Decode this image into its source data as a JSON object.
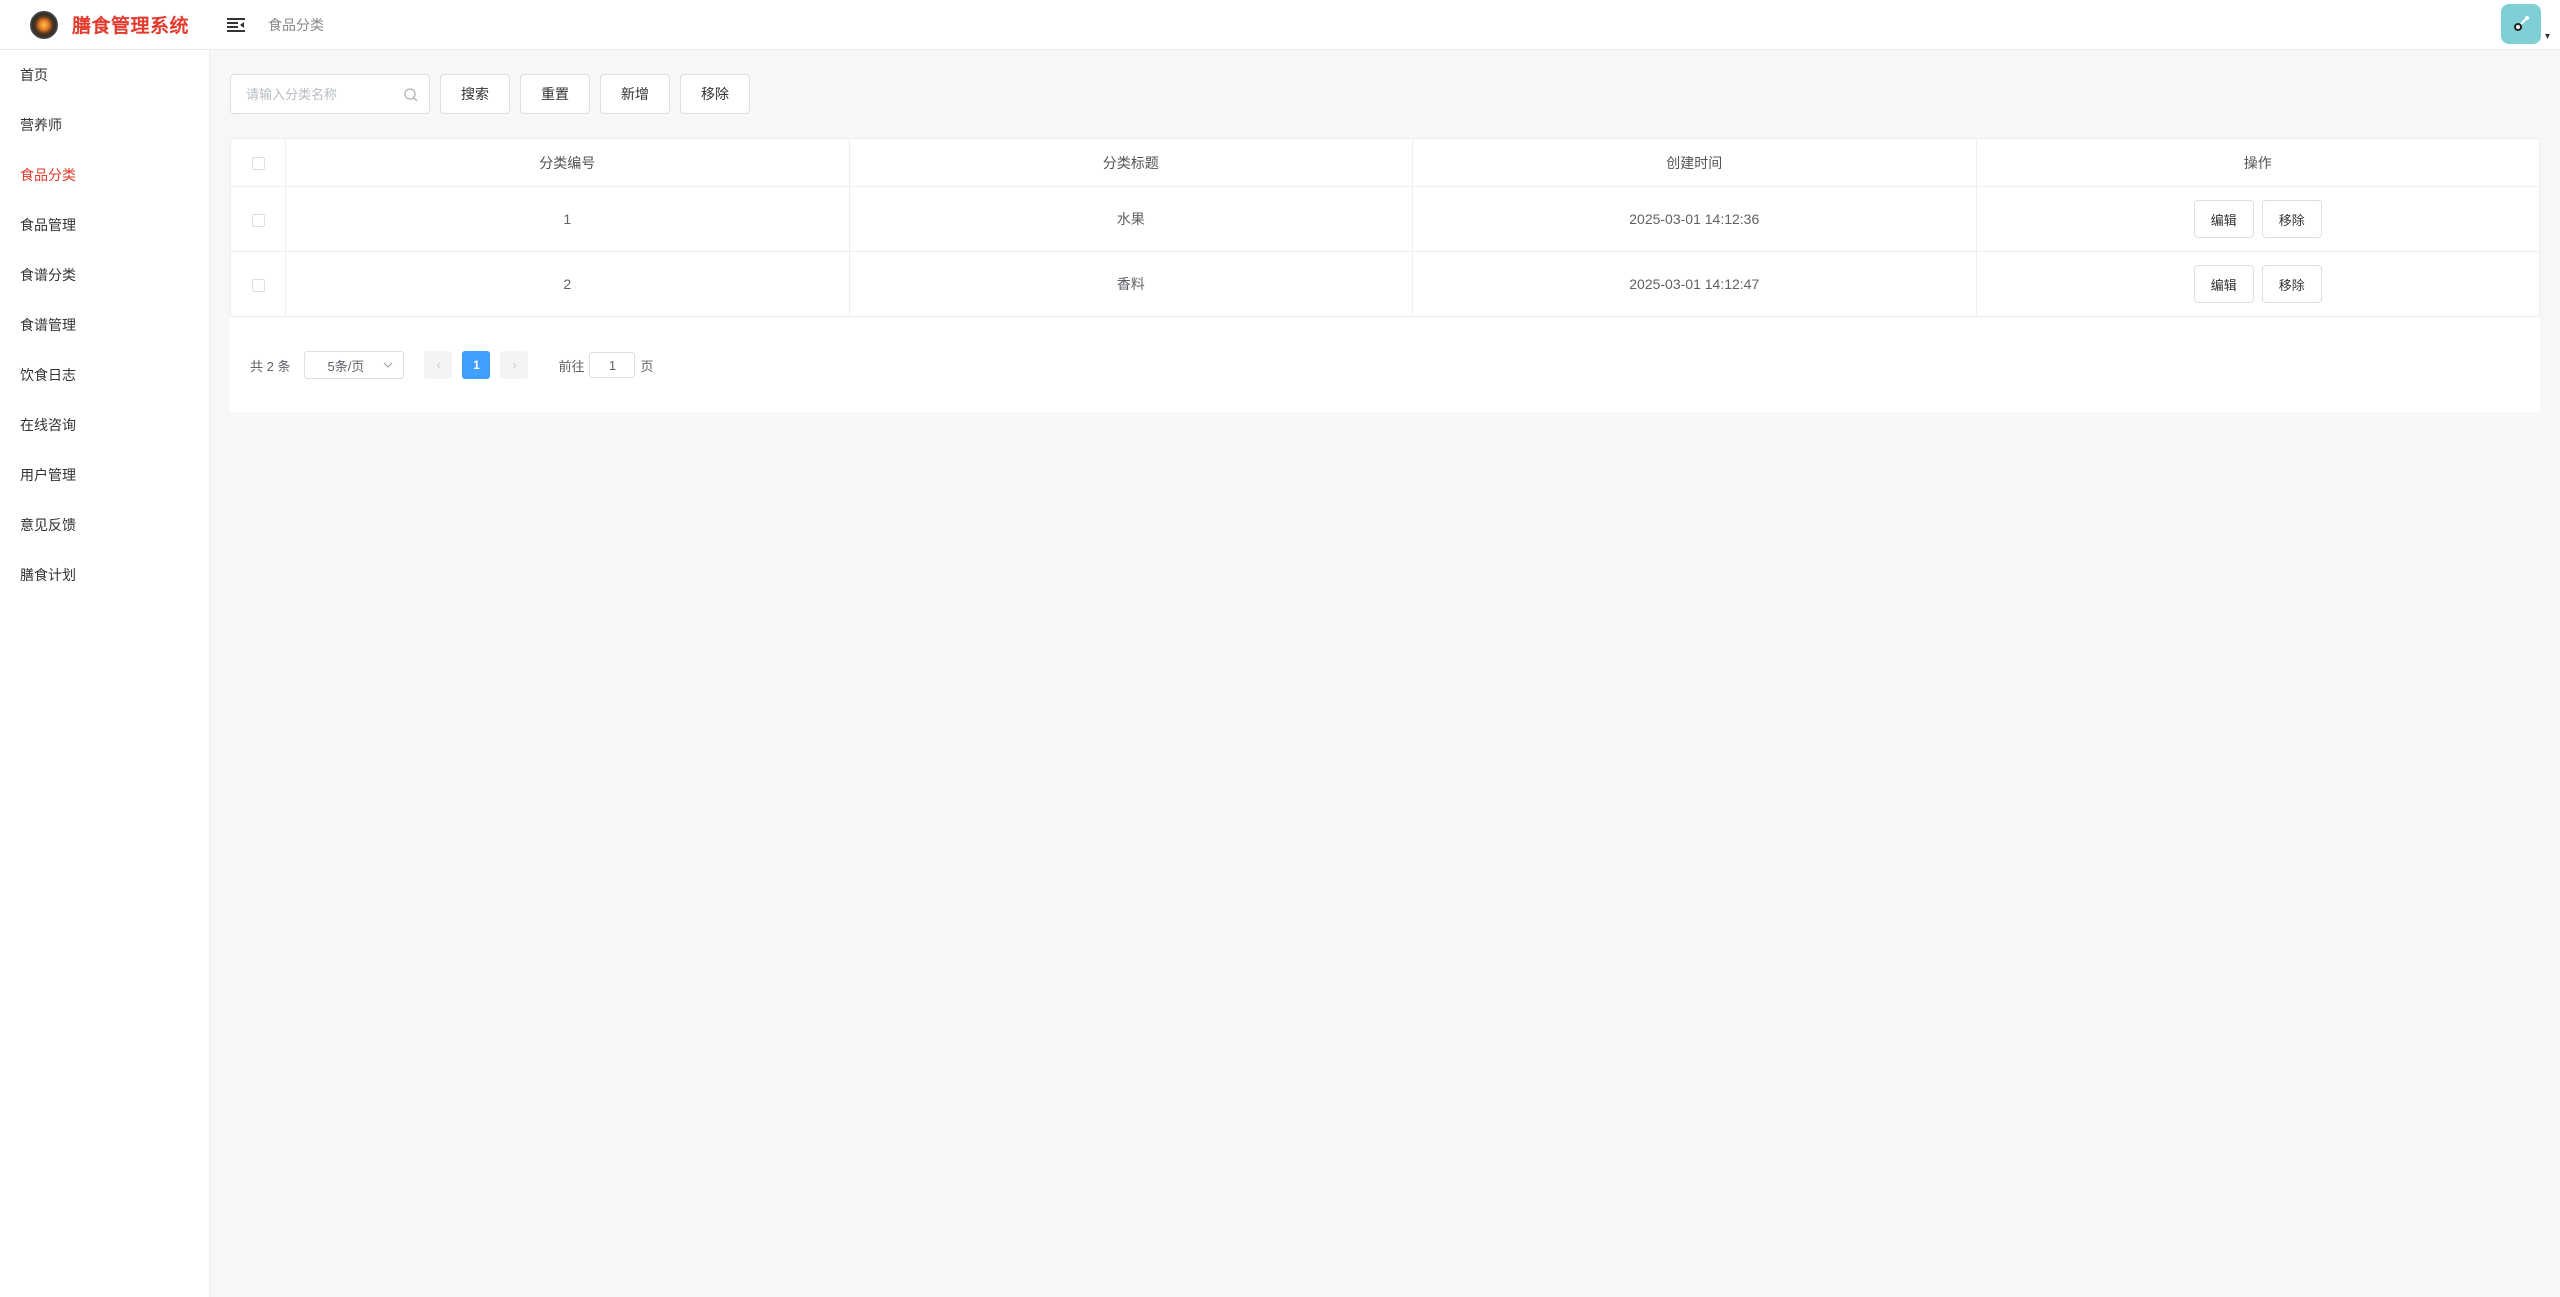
{
  "app": {
    "title": "膳食管理系统",
    "accent_color": "#e23b2e"
  },
  "header": {
    "menu_icon": "menu-fold-icon",
    "breadcrumb": "食品分类",
    "avatar_icon": "avatar-icon",
    "avatar_caret": "▾"
  },
  "sidebar": {
    "items": [
      {
        "label": "首页",
        "active": false
      },
      {
        "label": "营养师",
        "active": false
      },
      {
        "label": "食品分类",
        "active": true
      },
      {
        "label": "食品管理",
        "active": false
      },
      {
        "label": "食谱分类",
        "active": false
      },
      {
        "label": "食谱管理",
        "active": false
      },
      {
        "label": "饮食日志",
        "active": false
      },
      {
        "label": "在线咨询",
        "active": false
      },
      {
        "label": "用户管理",
        "active": false
      },
      {
        "label": "意见反馈",
        "active": false
      },
      {
        "label": "膳食计划",
        "active": false
      }
    ]
  },
  "toolbar": {
    "search_placeholder": "请输入分类名称",
    "search_value": "",
    "search_label": "搜索",
    "reset_label": "重置",
    "add_label": "新增",
    "remove_label": "移除"
  },
  "table": {
    "columns": [
      "分类编号",
      "分类标题",
      "创建时间",
      "操作"
    ],
    "rows": [
      {
        "id": "1",
        "title": "水果",
        "created": "2025-03-01 14:12:36",
        "edit": "编辑",
        "remove": "移除"
      },
      {
        "id": "2",
        "title": "香料",
        "created": "2025-03-01 14:12:47",
        "edit": "编辑",
        "remove": "移除"
      }
    ]
  },
  "pagination": {
    "total_text": "共 2 条",
    "page_size": "5条/页",
    "prev": "‹",
    "current_page": "1",
    "next": "›",
    "goto_prefix": "前往",
    "goto_value": "1",
    "goto_suffix": "页",
    "active_color": "#409eff"
  }
}
